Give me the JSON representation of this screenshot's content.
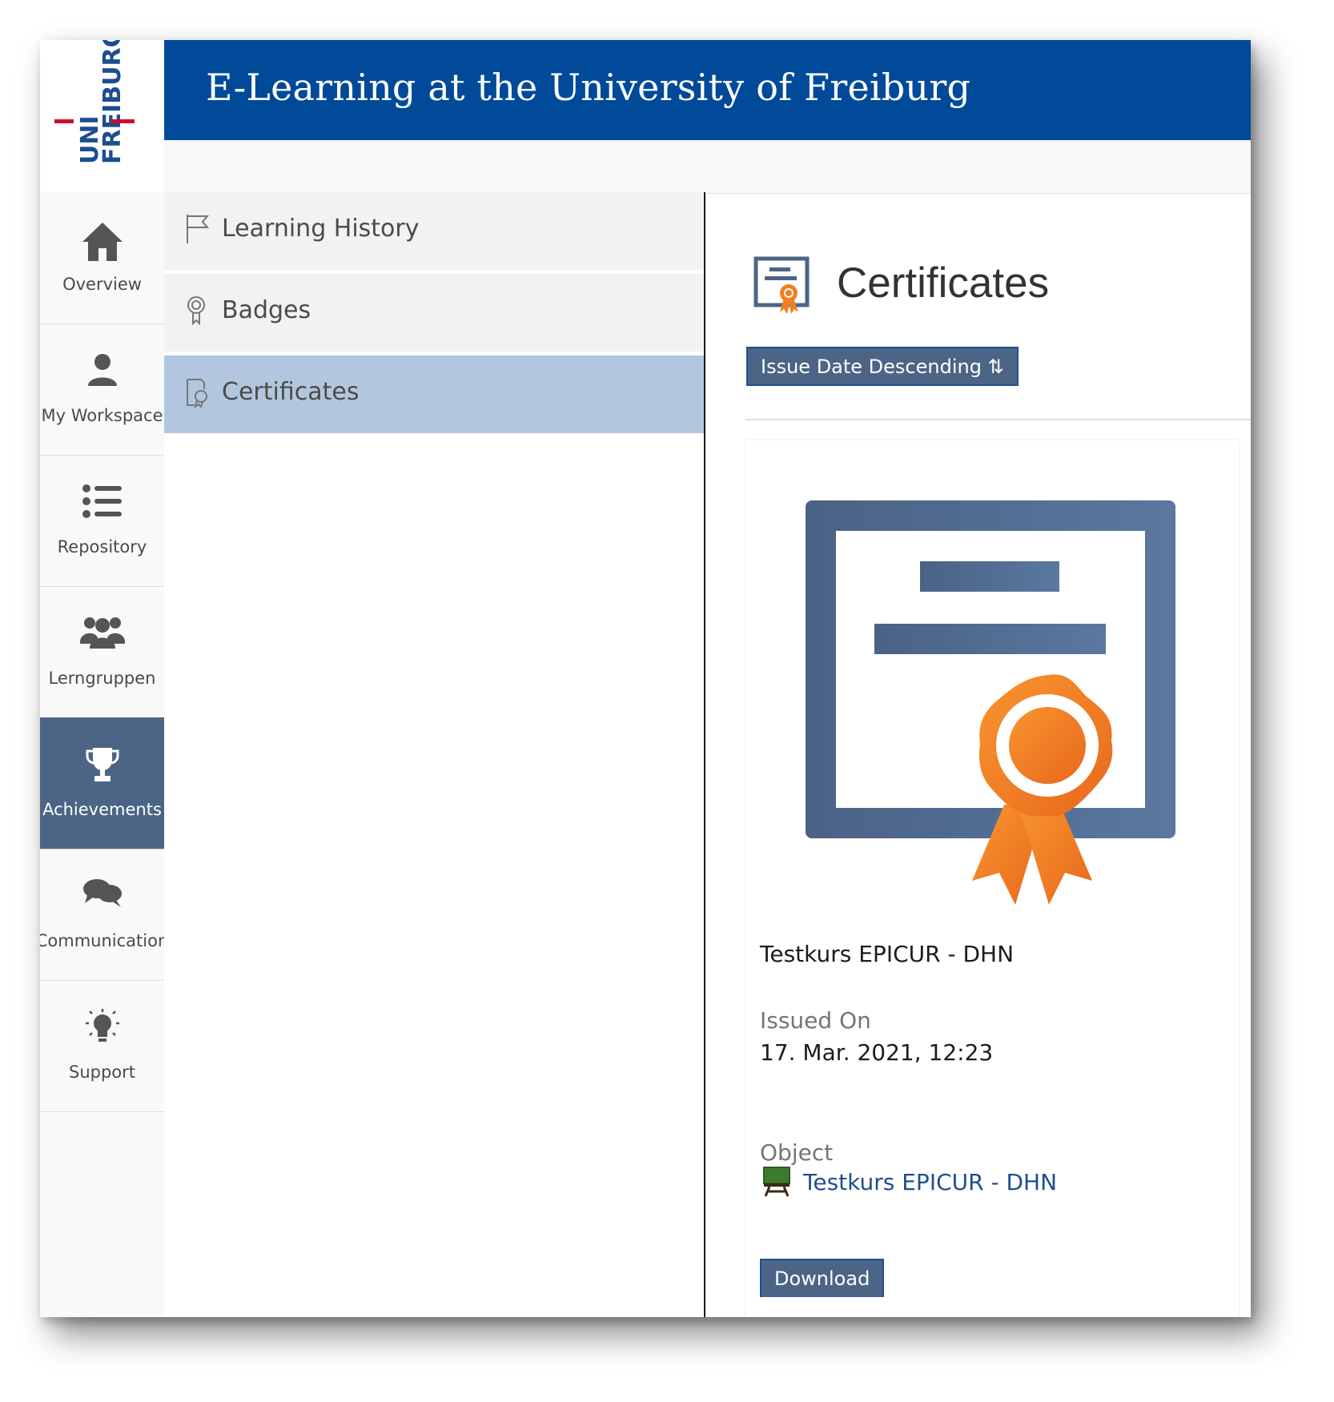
{
  "logo": {
    "line1": "UNI",
    "line2": "FREIBURG"
  },
  "header": {
    "title": "E-Learning at the University of Freiburg"
  },
  "mainbar": {
    "items": [
      {
        "label": "Overview",
        "icon": "home-icon"
      },
      {
        "label": "My Workspace",
        "icon": "user-icon"
      },
      {
        "label": "Repository",
        "icon": "list-icon"
      },
      {
        "label": "Lerngruppen",
        "icon": "users-icon"
      },
      {
        "label": "Achievements",
        "icon": "trophy-icon",
        "active": true
      },
      {
        "label": "Communication",
        "icon": "chat-icon"
      },
      {
        "label": "Support",
        "icon": "lightbulb-icon"
      }
    ]
  },
  "slate": {
    "items": [
      {
        "label": "Learning History",
        "icon": "flag-icon"
      },
      {
        "label": "Badges",
        "icon": "badge-icon"
      },
      {
        "label": "Certificates",
        "icon": "certificate-icon",
        "active": true
      }
    ]
  },
  "content": {
    "title": "Certificates",
    "sort_label": "Issue Date Descending ⇅",
    "card": {
      "title": "Testkurs EPICUR - DHN",
      "issued_label": "Issued On",
      "issued_value": "17. Mar. 2021, 12:23",
      "object_label": "Object",
      "object_link": "Testkurs EPICUR - DHN",
      "object_icon": "course-icon",
      "download_label": "Download"
    }
  },
  "colors": {
    "header_blue": "#004a99",
    "active_blue": "#4c6586",
    "slate_active": "#b2c7df",
    "accent_orange": "#f07f1f",
    "link_blue": "#1f4f8c"
  }
}
